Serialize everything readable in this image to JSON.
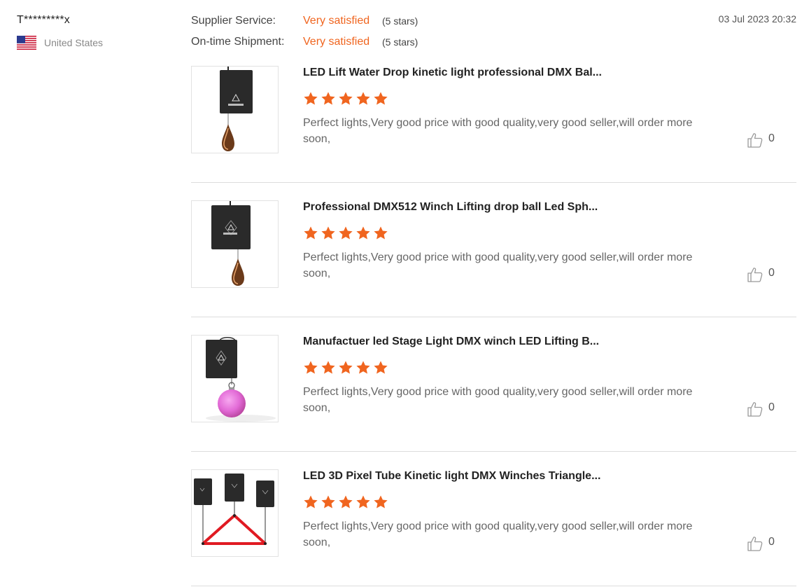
{
  "reviewer": {
    "name": "T*********x",
    "country": "United States"
  },
  "ratings": {
    "supplier_service": {
      "label": "Supplier Service:",
      "value": "Very satisfied",
      "stars": "(5 stars)"
    },
    "on_time_shipment": {
      "label": "On-time Shipment:",
      "value": "Very satisfied",
      "stars": "(5 stars)"
    }
  },
  "review_date": "03 Jul 2023 20:32",
  "colors": {
    "accent": "#f0651f",
    "star": "#f0651f",
    "divider": "#dddddd"
  },
  "products": [
    {
      "title": "LED Lift Water Drop kinetic light professional DMX Bal...",
      "rating": 5,
      "comment": "Perfect lights,Very good price with good quality,very good seller,will order more soon,",
      "likes": "0",
      "image_icon": "kinetic-water-drop-light-image"
    },
    {
      "title": "Professional DMX512 Winch Lifting drop ball Led Sph...",
      "rating": 5,
      "comment": "Perfect lights,Very good price with good quality,very good seller,will order more soon,",
      "likes": "0",
      "image_icon": "dmx-winch-drop-light-image"
    },
    {
      "title": "Manufactuer led Stage Light DMX winch LED Lifting B...",
      "rating": 5,
      "comment": "Perfect lights,Very good price with good quality,very good seller,will order more soon,",
      "likes": "0",
      "image_icon": "dmx-winch-pink-ball-image"
    },
    {
      "title": "LED 3D Pixel Tube Kinetic light DMX Winches Triangle...",
      "rating": 5,
      "comment": "Perfect lights,Very good price with good quality,very good seller,will order more soon,",
      "likes": "0",
      "image_icon": "triangle-pixel-tube-winches-image"
    }
  ]
}
